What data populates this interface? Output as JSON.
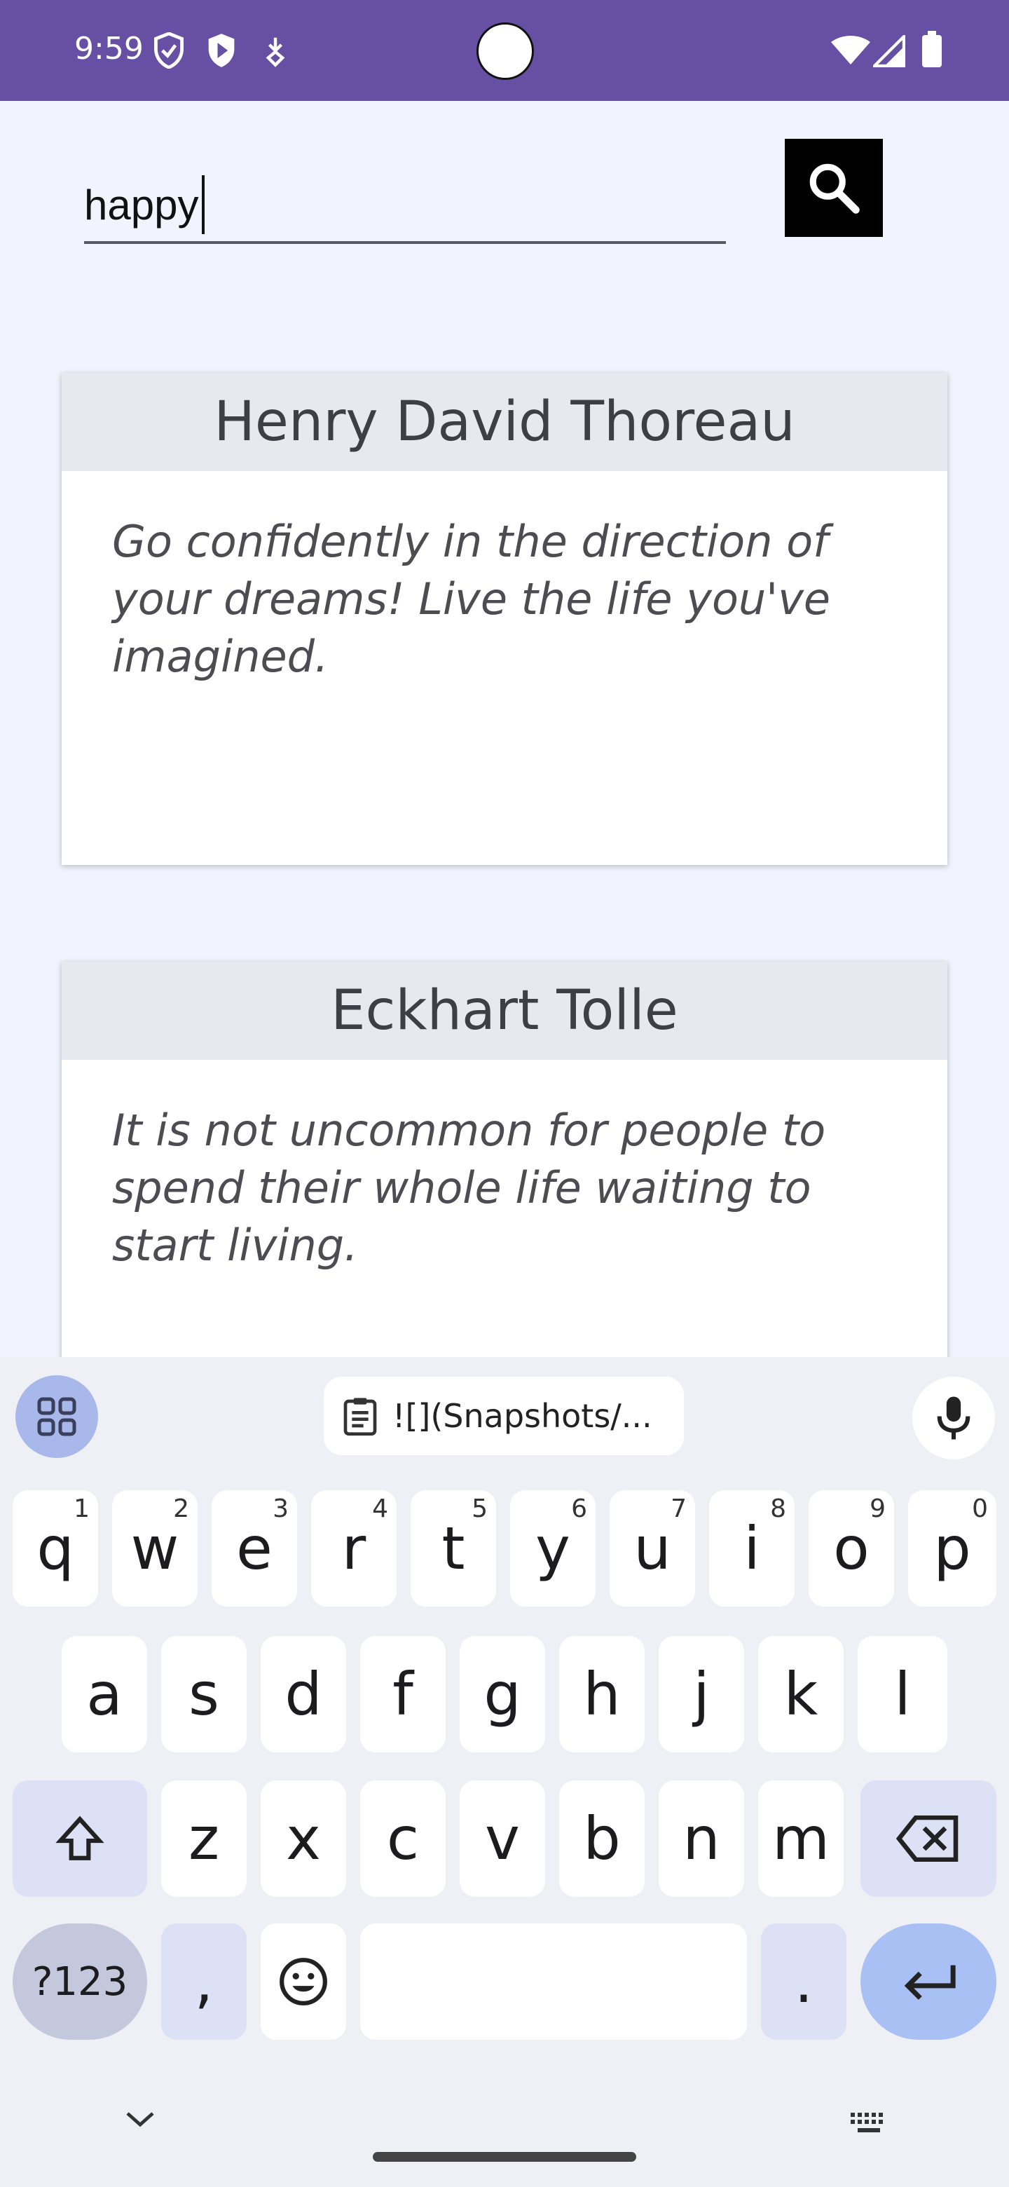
{
  "status_bar": {
    "time": "9:59",
    "background": "#6750a4"
  },
  "search": {
    "value": "happy",
    "button_icon": "search-icon"
  },
  "quotes": [
    {
      "author": "Henry David Thoreau",
      "quote": "Go confidently in the direction of your dreams! Live the life you've imagined."
    },
    {
      "author": "Eckhart Tolle",
      "quote": "It is not uncommon for people to spend their whole life waiting to start living."
    }
  ],
  "keyboard": {
    "clipboard_chip": "![](Snapshots/...",
    "row1": [
      {
        "key": "q",
        "hint": "1"
      },
      {
        "key": "w",
        "hint": "2"
      },
      {
        "key": "e",
        "hint": "3"
      },
      {
        "key": "r",
        "hint": "4"
      },
      {
        "key": "t",
        "hint": "5"
      },
      {
        "key": "y",
        "hint": "6"
      },
      {
        "key": "u",
        "hint": "7"
      },
      {
        "key": "i",
        "hint": "8"
      },
      {
        "key": "o",
        "hint": "9"
      },
      {
        "key": "p",
        "hint": "0"
      }
    ],
    "row2": [
      "a",
      "s",
      "d",
      "f",
      "g",
      "h",
      "j",
      "k",
      "l"
    ],
    "row3": [
      "z",
      "x",
      "c",
      "v",
      "b",
      "n",
      "m"
    ],
    "symbols_label": "?123",
    "comma": ",",
    "period": "."
  }
}
